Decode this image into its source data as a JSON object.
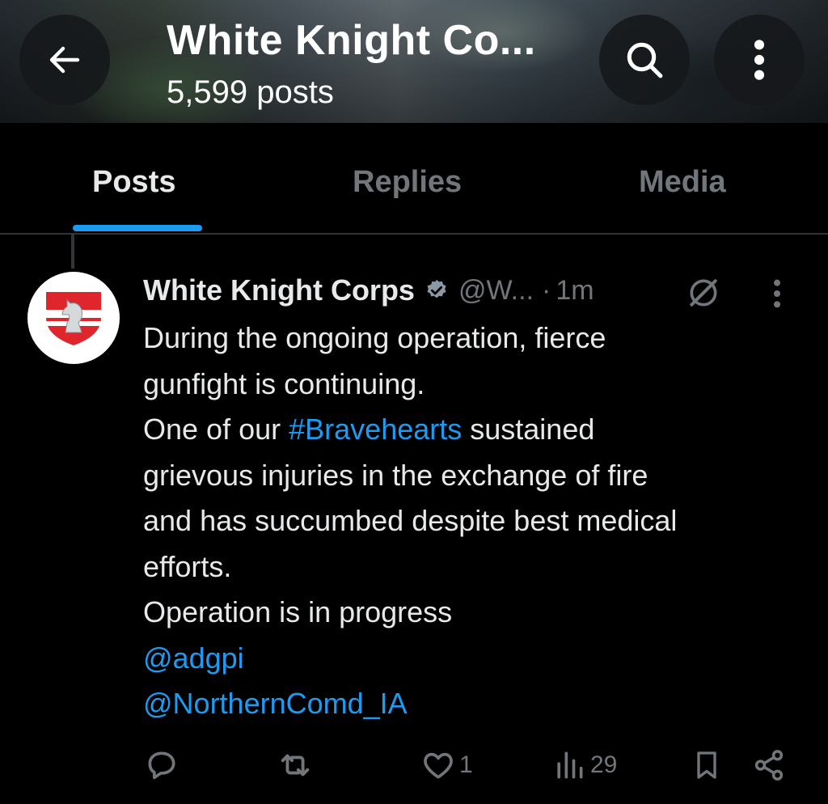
{
  "header": {
    "title": "White Knight Co...",
    "post_count": "5,599 posts",
    "icons": {
      "back": "arrow-left-icon",
      "search": "search-icon",
      "more": "more-vertical-icon"
    }
  },
  "tabs": [
    {
      "label": "Posts",
      "active": true
    },
    {
      "label": "Replies",
      "active": false
    },
    {
      "label": "Media",
      "active": false
    }
  ],
  "colors": {
    "accent": "#1d9bf0",
    "background": "#000000",
    "text": "#e7e9ea",
    "muted": "#71767b"
  },
  "post": {
    "author_name": "White Knight Corps",
    "verified": true,
    "handle": "@W...",
    "separator": "·",
    "time": "1m",
    "body": {
      "l1": "During the ongoing operation, fierce",
      "l2": "gunfight is continuing.",
      "l3_pre": "One of our",
      "l3_tag": "#Bravehearts",
      "l3_post": "sustained",
      "l4": "grievous injuries in the exchange of fire",
      "l5": "and has succumbed despite best medical",
      "l6": "efforts.",
      "l7": "Operation is in progress",
      "mention1": "@adgpi",
      "mention2": "@NorthernComd_IA"
    },
    "actions": {
      "reply_count": "",
      "repost_count": "",
      "like_count": "1",
      "views_count": "29"
    }
  }
}
